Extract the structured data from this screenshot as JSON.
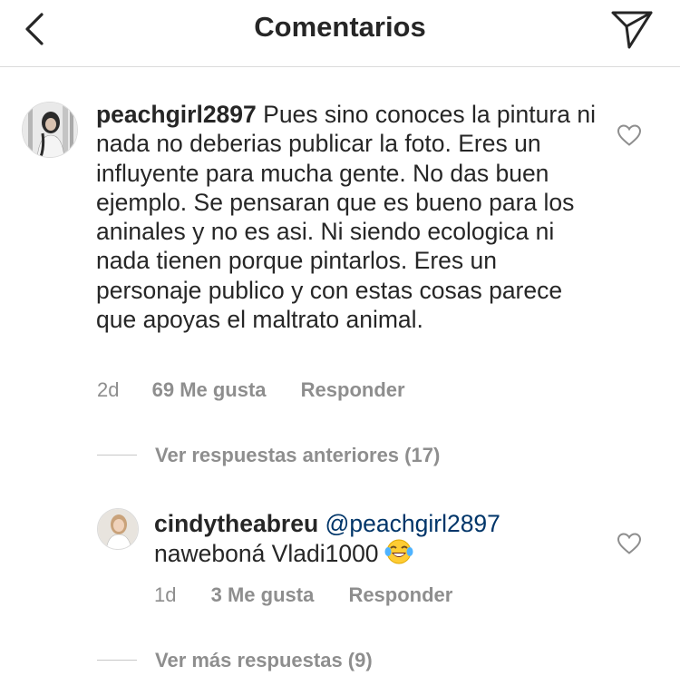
{
  "header": {
    "title": "Comentarios",
    "back_icon": "chevron-left-icon",
    "send_icon": "direct-send-icon"
  },
  "comments": [
    {
      "username": "peachgirl2897",
      "text": " Pues sino conoces la pintura ni nada no deberias publicar la foto. Eres un influyente para mucha gente. No das buen ejemplo. Se pensaran que es bueno para los aninales y no es asi. Ni siendo ecologica ni nada tienen porque pintarlos. Eres un personaje publico y con estas cosas parece que apoyas el maltrato animal.",
      "time": "2d",
      "likes": "69 Me gusta",
      "reply": "Responder"
    }
  ],
  "view_previous_replies": "Ver respuestas anteriores (17)",
  "replies": [
    {
      "username": "cindytheabreu",
      "mention": "@peachgirl2897",
      "text": "naweboná Vladi1000",
      "emoji": "face-with-tears-of-joy",
      "time": "1d",
      "likes": "3 Me gusta",
      "reply": "Responder"
    }
  ],
  "view_more_replies": "Ver más respuestas (9)",
  "colors": {
    "text": "#262626",
    "muted": "#8e8e8e",
    "mention": "#003569",
    "divider": "#dbdbdb"
  }
}
